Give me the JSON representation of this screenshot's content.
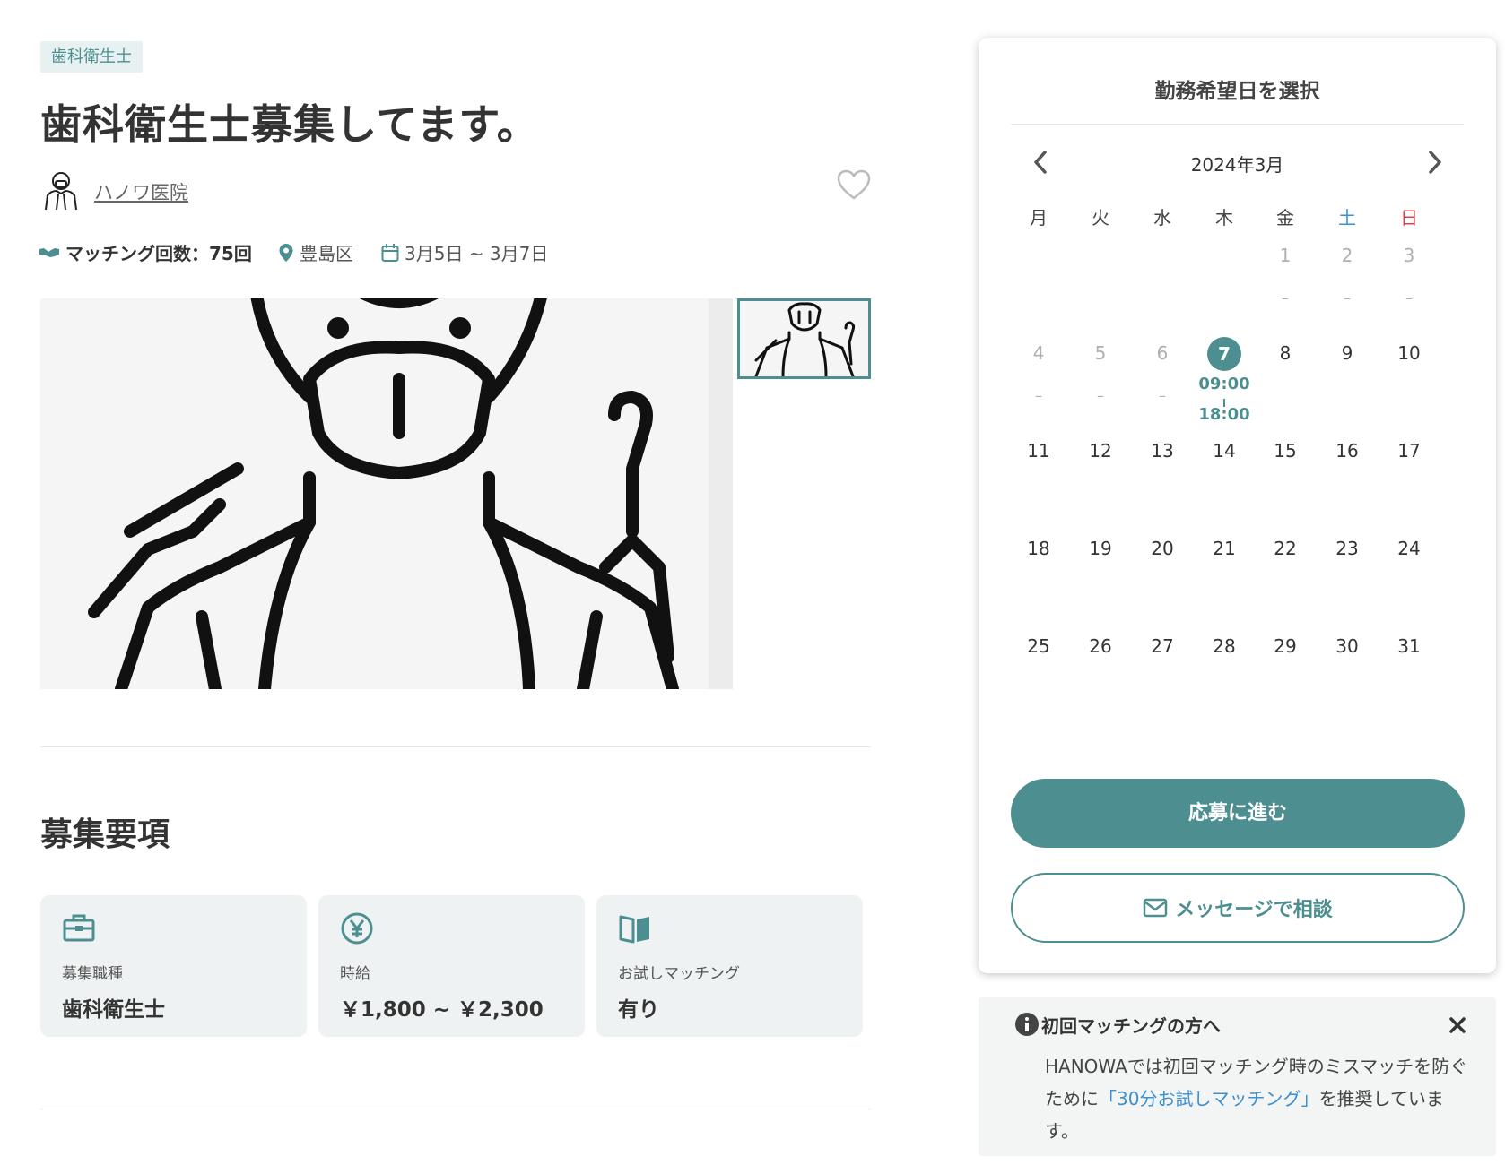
{
  "job": {
    "tag": "歯科衛生士",
    "title": "歯科衛生士募集してます。",
    "clinic_name": "ハノワ医院",
    "matching_count": "マッチング回数：75回",
    "location": "豊島区",
    "period": "3月5日 ~ 3月7日"
  },
  "requirements": {
    "heading": "募集要項",
    "cards": [
      {
        "label": "募集職種",
        "value": "歯科衛生士",
        "icon": "briefcase-icon"
      },
      {
        "label": "時給",
        "value": "￥1,800 ~ ￥2,300",
        "icon": "yen-icon"
      },
      {
        "label": "お試しマッチング",
        "value": "有り",
        "icon": "book-icon"
      }
    ]
  },
  "calendar": {
    "title": "勤務希望日を選択",
    "month": "2024年3月",
    "weekdays": [
      "月",
      "火",
      "水",
      "木",
      "金",
      "土",
      "日"
    ],
    "saturday_color": "#3d8fd0",
    "sunday_color": "#d9464b",
    "selected_day": "7",
    "selected_start": "09:00",
    "selected_end": "18:00",
    "days": [
      "1",
      "2",
      "3",
      "4",
      "5",
      "6",
      "7",
      "8",
      "9",
      "10",
      "11",
      "12",
      "13",
      "14",
      "15",
      "16",
      "17",
      "18",
      "19",
      "20",
      "21",
      "22",
      "23",
      "24",
      "25",
      "26",
      "27",
      "28",
      "29",
      "30",
      "31"
    ],
    "unavailable_mark": "–",
    "apply_label": "応募に進む",
    "message_label": "メッセージで相談"
  },
  "notice": {
    "title": "初回マッチングの方へ",
    "body_before": "HANOWAでは初回マッチング時のミスマッチを防ぐために",
    "link_text": "「30分お試しマッチング」",
    "body_after": "を推奨しています。"
  },
  "colors": {
    "accent": "#4d8f91",
    "link": "#3d8fd0"
  }
}
